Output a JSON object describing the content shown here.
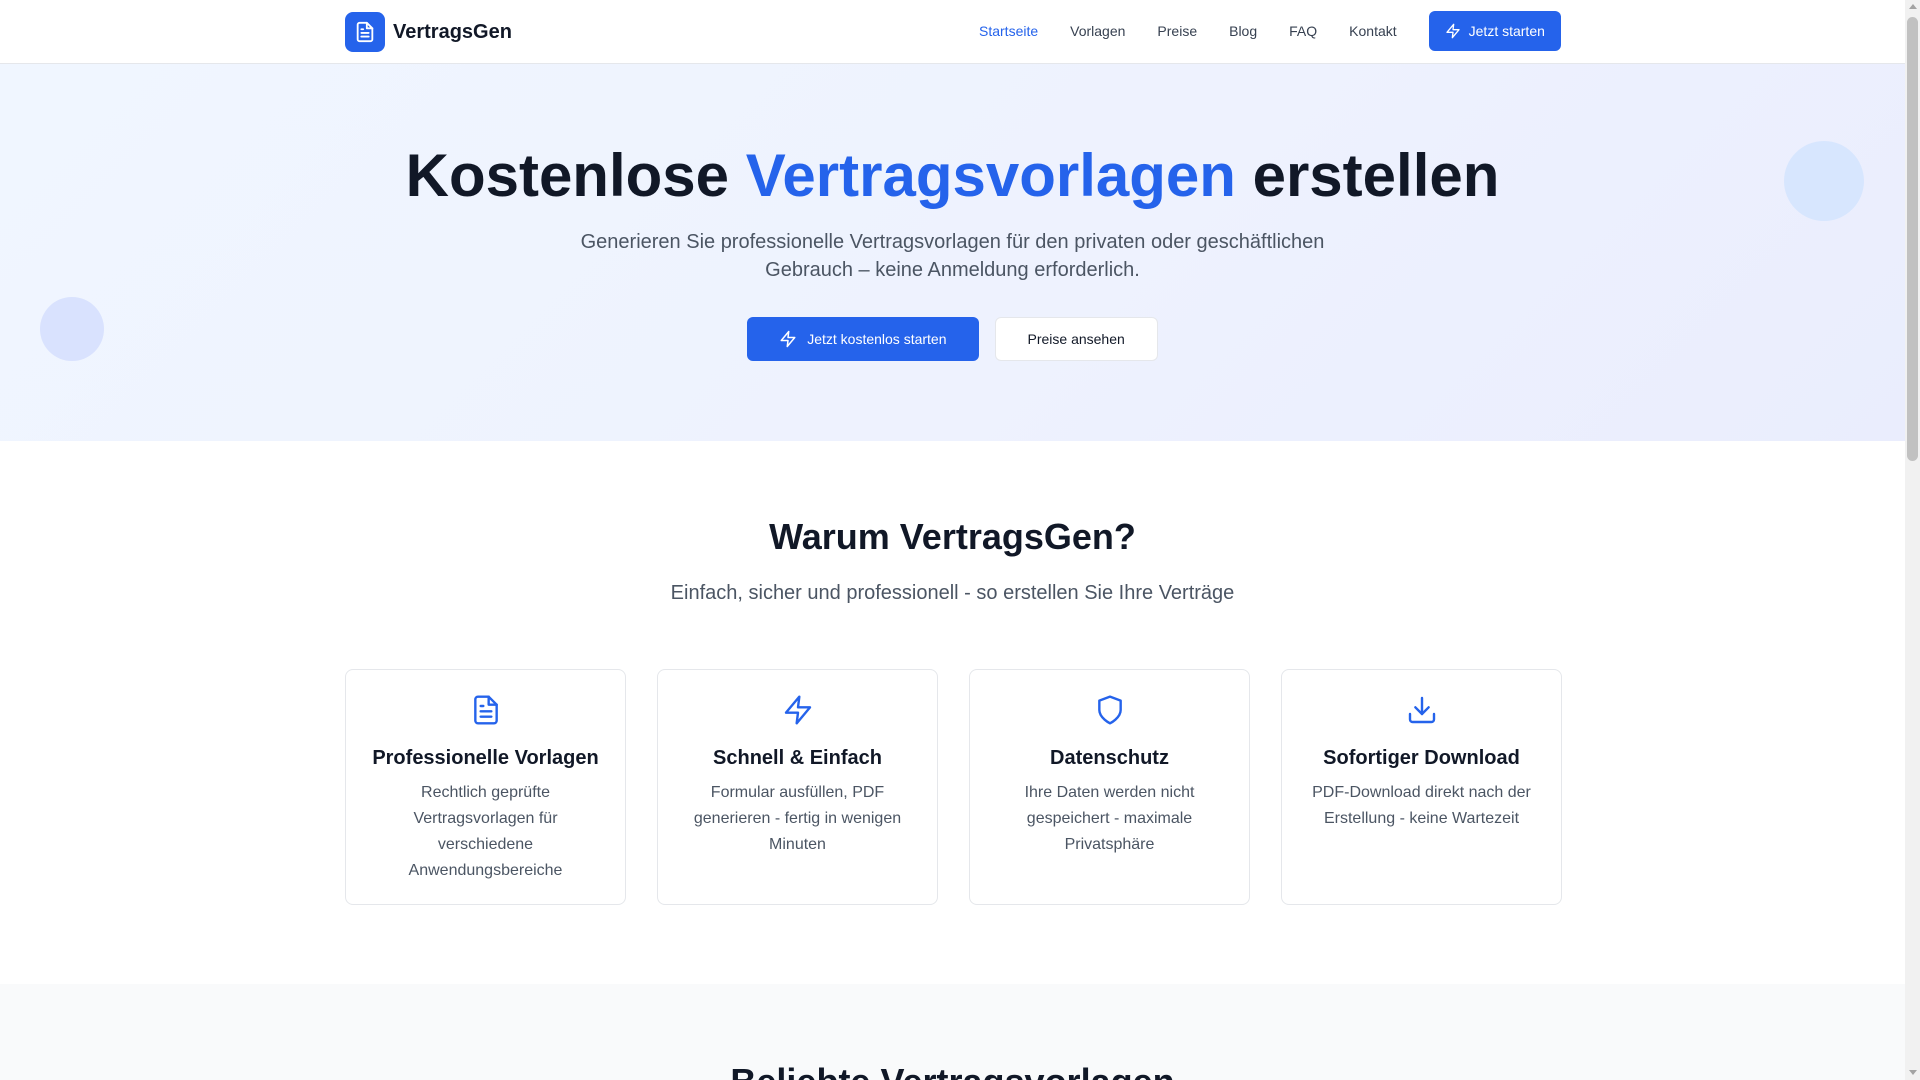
{
  "header": {
    "brand": "VertragsGen",
    "logo_icon": "file-text-icon",
    "nav": [
      {
        "label": "Startseite",
        "active": true
      },
      {
        "label": "Vorlagen",
        "active": false
      },
      {
        "label": "Preise",
        "active": false
      },
      {
        "label": "Blog",
        "active": false
      },
      {
        "label": "FAQ",
        "active": false
      },
      {
        "label": "Kontakt",
        "active": false
      }
    ],
    "cta_label": "Jetzt starten",
    "cta_icon": "zap-icon"
  },
  "hero": {
    "title_part1": "Kostenlose ",
    "title_accent": "Vertragsvorlagen",
    "title_part2": " erstellen",
    "subtitle": "Generieren Sie professionelle Vertragsvorlagen für den privaten oder geschäftlichen Gebrauch – keine Anmeldung erforderlich.",
    "primary_label": "Jetzt kostenlos starten",
    "secondary_label": "Preise ansehen"
  },
  "features": {
    "title": "Warum VertragsGen?",
    "subtitle": "Einfach, sicher und professionell - so erstellen Sie Ihre Verträge",
    "cards": [
      {
        "icon": "file-text-icon",
        "title": "Professionelle Vorlagen",
        "description": "Rechtlich geprüfte Vertragsvorlagen für verschiedene Anwendungsbereiche"
      },
      {
        "icon": "zap-icon",
        "title": "Schnell & Einfach",
        "description": "Formular ausfüllen, PDF generieren - fertig in wenigen Minuten"
      },
      {
        "icon": "shield-icon",
        "title": "Datenschutz",
        "description": "Ihre Daten werden nicht gespeichert - maximale Privatsphäre"
      },
      {
        "icon": "download-icon",
        "title": "Sofortiger Download",
        "description": "PDF-Download direkt nach der Erstellung - keine Wartezeit"
      }
    ]
  },
  "popular": {
    "title": "Beliebte Vertragsvorlagen"
  },
  "colors": {
    "accent": "#2563eb",
    "text": "#111827",
    "muted": "#4b5563"
  }
}
